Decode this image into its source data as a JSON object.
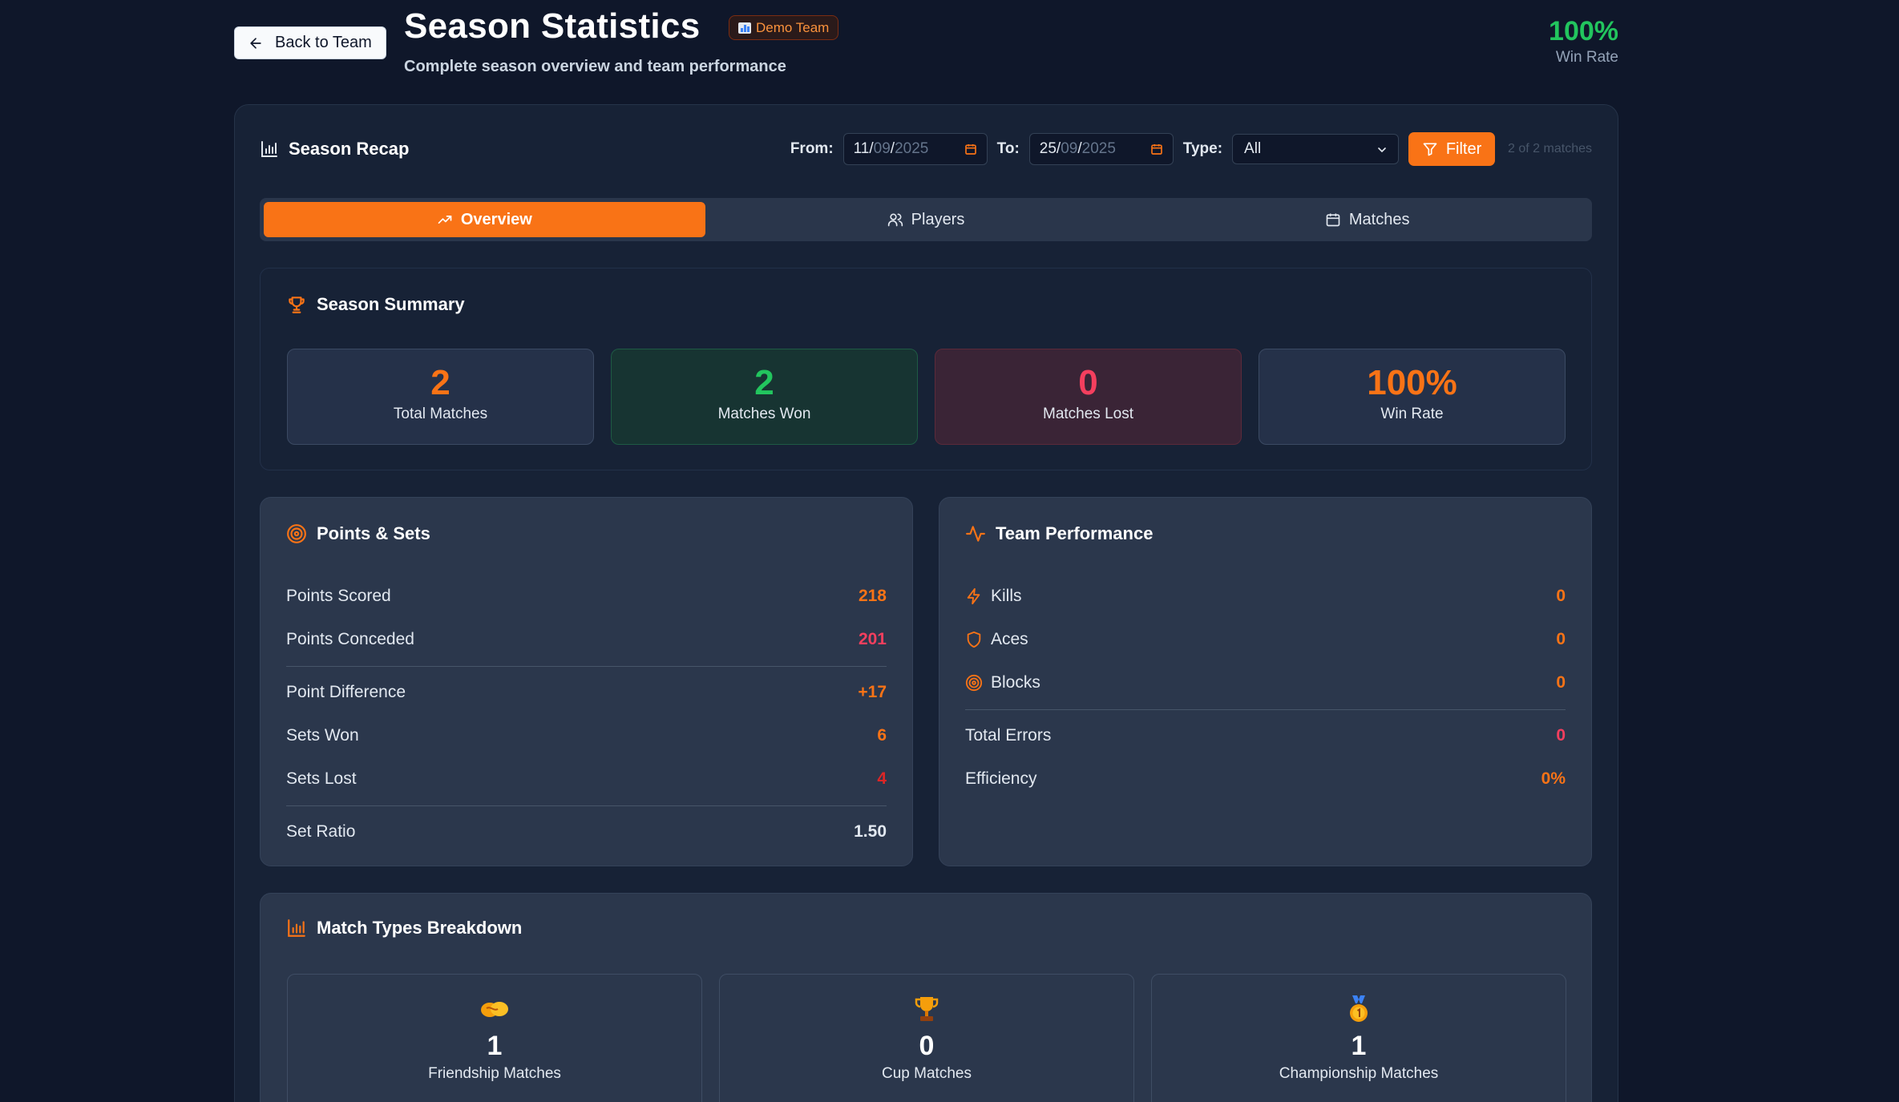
{
  "header": {
    "back_label": "Back to Team",
    "title": "Season Statistics",
    "badge": "Demo Team",
    "subtitle": "Complete season overview and team performance",
    "win_rate_value": "100%",
    "win_rate_label": "Win Rate"
  },
  "recap": {
    "title": "Season Recap",
    "from_label": "From:",
    "from_day": "11",
    "from_month": "09",
    "from_year": "2025",
    "to_label": "To:",
    "to_day": "25",
    "to_month": "09",
    "to_year": "2025",
    "sep": "/",
    "type_label": "Type:",
    "type_value": "All",
    "filter_label": "Filter",
    "match_count": "2 of 2 matches"
  },
  "tabs": [
    {
      "label": "Overview",
      "icon": "trending-up-icon",
      "active": true
    },
    {
      "label": "Players",
      "icon": "users-icon",
      "active": false
    },
    {
      "label": "Matches",
      "icon": "calendar-icon",
      "active": false
    }
  ],
  "summary": {
    "title": "Season Summary",
    "stats": [
      {
        "value": "2",
        "label": "Total Matches",
        "color": "#f97316"
      },
      {
        "value": "2",
        "label": "Matches Won",
        "color": "#22c55e"
      },
      {
        "value": "0",
        "label": "Matches Lost",
        "color": "#f43f5e"
      },
      {
        "value": "100%",
        "label": "Win Rate",
        "color": "#f97316"
      }
    ]
  },
  "points_sets": {
    "title": "Points & Sets",
    "points_scored_label": "Points Scored",
    "points_scored": "218",
    "points_conceded_label": "Points Conceded",
    "points_conceded": "201",
    "point_diff_label": "Point Difference",
    "point_diff": "+17",
    "sets_won_label": "Sets Won",
    "sets_won": "6",
    "sets_lost_label": "Sets Lost",
    "sets_lost": "4",
    "set_ratio_label": "Set Ratio",
    "set_ratio": "1.50"
  },
  "team_performance": {
    "title": "Team Performance",
    "kills_label": "Kills",
    "kills": "0",
    "aces_label": "Aces",
    "aces": "0",
    "blocks_label": "Blocks",
    "blocks": "0",
    "errors_label": "Total Errors",
    "errors": "0",
    "efficiency_label": "Efficiency",
    "efficiency": "0%"
  },
  "match_types": {
    "title": "Match Types Breakdown",
    "items": [
      {
        "value": "1",
        "label": "Friendship Matches",
        "icon": "handshake-icon"
      },
      {
        "value": "0",
        "label": "Cup Matches",
        "icon": "trophy-icon"
      },
      {
        "value": "1",
        "label": "Championship Matches",
        "icon": "medal-icon"
      }
    ]
  }
}
